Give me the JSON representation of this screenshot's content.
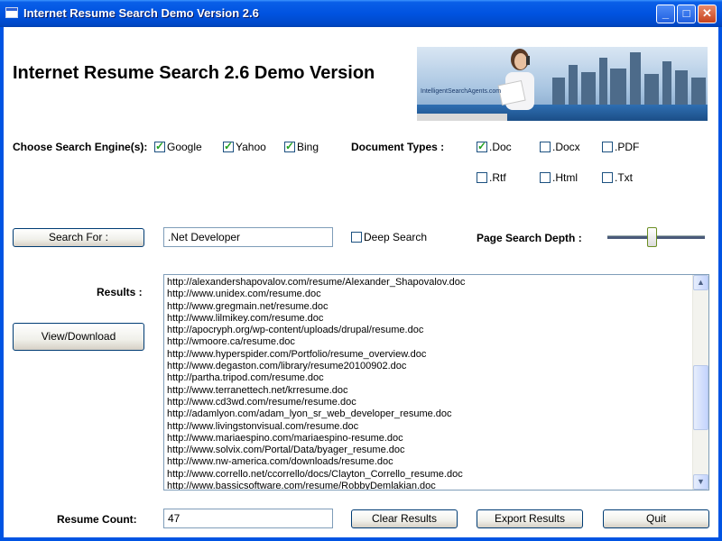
{
  "window": {
    "title": "Internet Resume Search Demo Version 2.6",
    "controls": {
      "minimize": "_",
      "maximize": "□",
      "close": "✕"
    }
  },
  "header": {
    "heading": "Internet Resume Search 2.6 Demo Version",
    "banner_text": "IntelligentSearchAgents.com"
  },
  "engines": {
    "label": "Choose Search Engine(s):",
    "items": [
      {
        "label": "Google",
        "checked": true
      },
      {
        "label": "Yahoo",
        "checked": true
      },
      {
        "label": "Bing",
        "checked": true
      }
    ]
  },
  "doctypes": {
    "label": "Document Types :",
    "items": [
      {
        "label": ".Doc",
        "checked": true
      },
      {
        "label": ".Docx",
        "checked": false
      },
      {
        "label": ".PDF",
        "checked": false
      },
      {
        "label": ".Rtf",
        "checked": false
      },
      {
        "label": ".Html",
        "checked": false
      },
      {
        "label": ".Txt",
        "checked": false
      }
    ]
  },
  "search": {
    "button": "Search For :",
    "query": ".Net Developer",
    "deep_label": "Deep Search",
    "deep_checked": false,
    "depth_label": "Page Search Depth :",
    "depth_fraction": 0.45
  },
  "results": {
    "label": "Results :",
    "view_button": "View/Download",
    "items": [
      "http://alexandershapovalov.com/resume/Alexander_Shapovalov.doc",
      "http://www.unidex.com/resume.doc",
      "http://www.gregmain.net/resume.doc",
      "http://www.lilmikey.com/resume.doc",
      "http://apocryph.org/wp-content/uploads/drupal/resume.doc",
      "http://wmoore.ca/resume.doc",
      "http://www.hyperspider.com/Portfolio/resume_overview.doc",
      "http://www.degaston.com/library/resume20100902.doc",
      "http://partha.tripod.com/resume.doc",
      "http://www.terranettech.net/krresume.doc",
      "http://www.cd3wd.com/resume/resume.doc",
      "http://adamlyon.com/adam_lyon_sr_web_developer_resume.doc",
      "http://www.livingstonvisual.com/resume.doc",
      "http://www.mariaespino.com/mariaespino-resume.doc",
      "http://www.solvix.com/Portal/Data/byager_resume.doc",
      "http://www.nw-america.com/downloads/resume.doc",
      "http://www.corrello.net/ccorrello/docs/Clayton_Corrello_resume.doc",
      "http://www.bassicsoftware.com/resume/RobbyDemlakian.doc"
    ]
  },
  "footer": {
    "count_label": "Resume Count:",
    "count_value": "47",
    "clear_button": "Clear Results",
    "export_button": "Export Results",
    "quit_button": "Quit"
  }
}
